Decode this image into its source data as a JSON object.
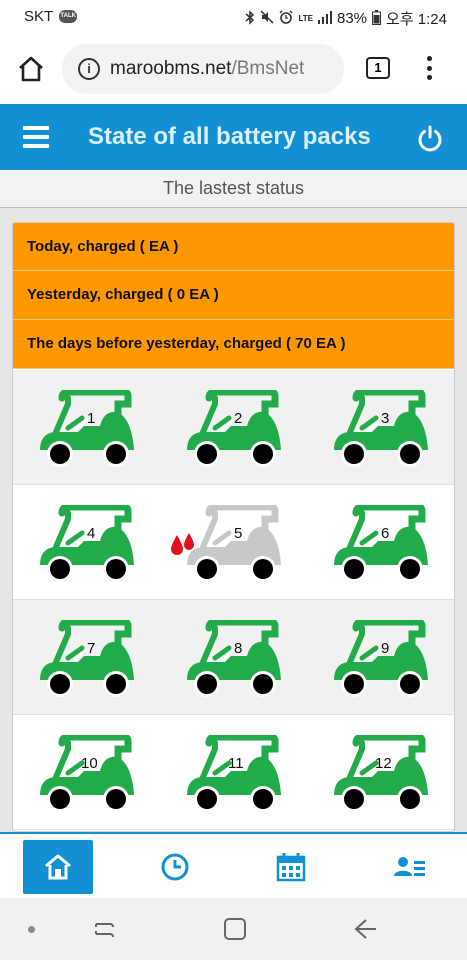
{
  "status_bar": {
    "carrier": "SKT",
    "talk_badge": "TALK",
    "network": "LTE",
    "battery": "83%",
    "time": "오후 1:24"
  },
  "browser": {
    "url_domain": "maroobms.net",
    "url_path": "/BmsNet",
    "tab_count": "1"
  },
  "header": {
    "title": "State of all battery packs"
  },
  "subheader": "The lastest status",
  "summary": [
    "Today, charged ( EA )",
    "Yesterday, charged ( 0 EA )",
    "The days before yesterday, charged ( 70 EA )"
  ],
  "carts": [
    {
      "number": "1",
      "state": "ok"
    },
    {
      "number": "2",
      "state": "ok"
    },
    {
      "number": "3",
      "state": "ok"
    },
    {
      "number": "4",
      "state": "ok"
    },
    {
      "number": "5",
      "state": "inactive"
    },
    {
      "number": "6",
      "state": "ok"
    },
    {
      "number": "7",
      "state": "ok"
    },
    {
      "number": "8",
      "state": "ok"
    },
    {
      "number": "9",
      "state": "ok"
    },
    {
      "number": "10",
      "state": "ok"
    },
    {
      "number": "11",
      "state": "ok"
    },
    {
      "number": "12",
      "state": "ok"
    }
  ],
  "colors": {
    "primary": "#1390d3",
    "summary_bg": "#fd9800",
    "cart_ok": "#22ab4a",
    "cart_inactive": "#c8c8c8",
    "drop": "#e3101e"
  },
  "tabs": [
    {
      "icon": "home-icon",
      "active": true
    },
    {
      "icon": "clock-icon",
      "active": false
    },
    {
      "icon": "calendar-icon",
      "active": false
    },
    {
      "icon": "user-list-icon",
      "active": false
    }
  ]
}
